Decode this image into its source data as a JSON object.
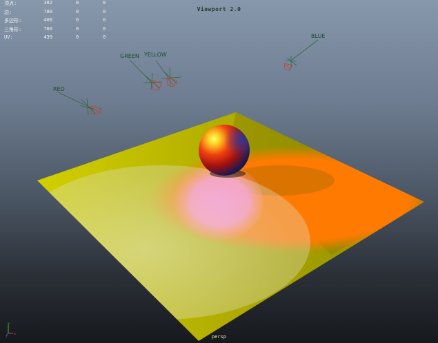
{
  "viewport": {
    "title": "Viewport 2.0",
    "camera": "persp"
  },
  "hud": {
    "rows": [
      {
        "label": "顶点:",
        "v1": "382",
        "v2": "0",
        "v3": "0"
      },
      {
        "label": "边:",
        "v1": "780",
        "v2": "0",
        "v3": "0"
      },
      {
        "label": "多边形:",
        "v1": "400",
        "v2": "0",
        "v3": "0"
      },
      {
        "label": "三角形:",
        "v1": "760",
        "v2": "0",
        "v3": "0"
      },
      {
        "label": "UV:",
        "v1": "439",
        "v2": "0",
        "v3": "0"
      }
    ]
  },
  "lights": [
    {
      "label": "RED",
      "color": "#c2361f"
    },
    {
      "label": "GREEN",
      "color": "#2e7a3a"
    },
    {
      "label": "YELLOW",
      "color": "#b5a02a"
    },
    {
      "label": "BLUE",
      "color": "#2a3fa8"
    }
  ],
  "axis": {
    "x": "x",
    "y": "y",
    "z": "z"
  },
  "colors": {
    "plane": "#c8c400",
    "orange_spot": "#ff7a10",
    "pink_spot": "#ff8adc",
    "sphere_highlight": "#ffff60",
    "sphere_main": "#e83010",
    "sphere_shadow": "#1c1e5a"
  }
}
